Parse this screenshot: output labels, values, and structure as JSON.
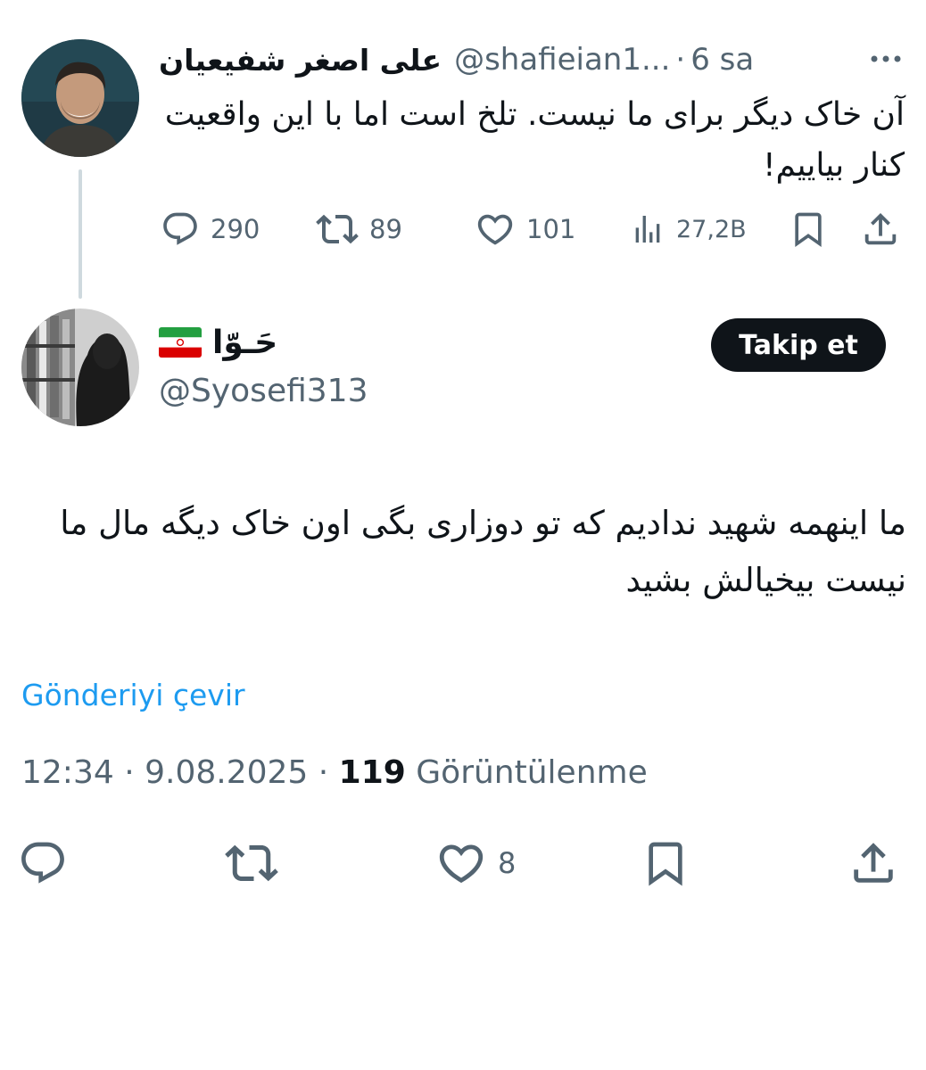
{
  "parent_tweet": {
    "author_name": "علی اصغر شفیعیان",
    "handle": "@shafieian1...",
    "time": "6 sa",
    "text": "آن خاک دیگر برای ما نیست. تلخ است اما با این واقعیت کنار بیاییم!",
    "stats": {
      "replies": "290",
      "retweets": "89",
      "likes": "101",
      "views": "27,2B"
    }
  },
  "reply_tweet": {
    "author_name": "حَـوّا",
    "handle": "@Syosefi313",
    "follow_label": "Takip et",
    "text": "ما اینهمه شهید ندادیم که تو دوزاری بگی اون خاک دیگه مال ما نیست بیخیالش بشید",
    "translate_label": "Gönderiyi çevir",
    "time": "12:34",
    "date": "9.08.2025",
    "views_count": "119",
    "views_label": "Görüntülenme",
    "likes": "8"
  },
  "colors": {
    "text_primary": "#0f1419",
    "text_secondary": "#536471",
    "link": "#1d9bf0",
    "thread_line": "#cfd9de"
  },
  "icons": [
    "reply-icon",
    "retweet-icon",
    "like-icon",
    "views-icon",
    "bookmark-icon",
    "share-icon",
    "more-icon",
    "iran-flag-icon"
  ]
}
